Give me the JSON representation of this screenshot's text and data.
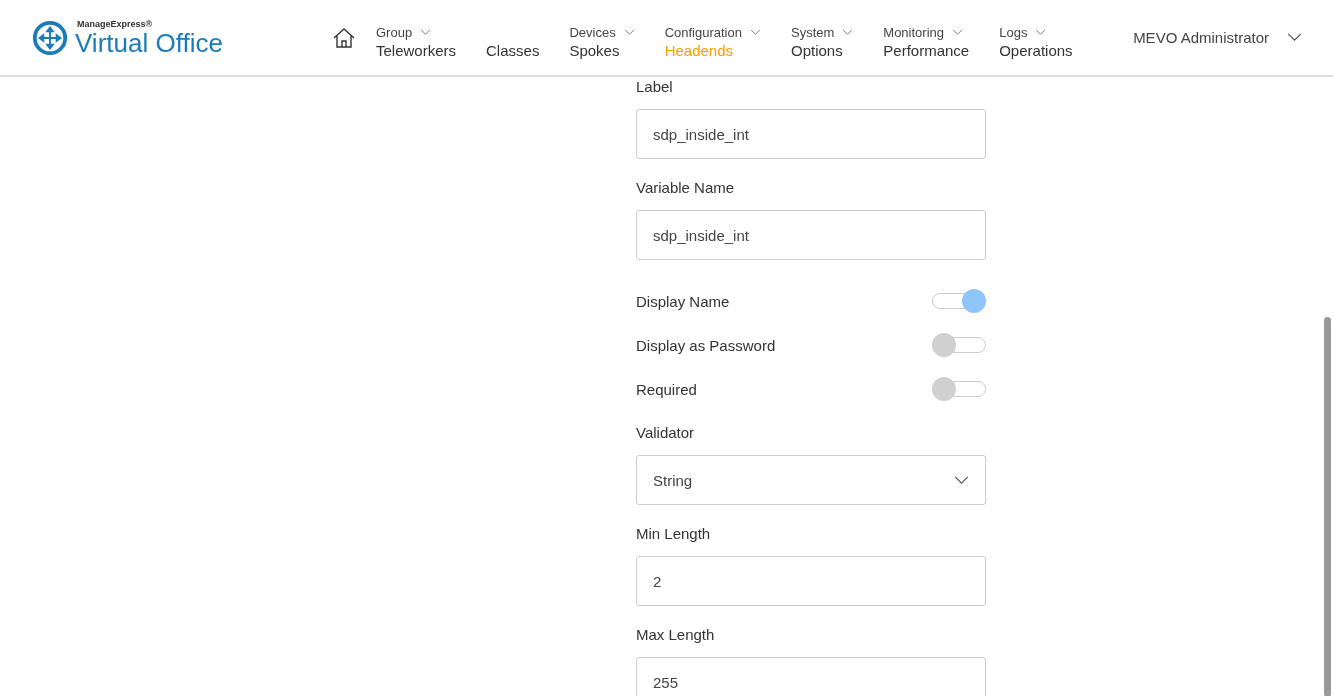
{
  "logo": {
    "brand": "ManageExpress®",
    "product": "Virtual Office"
  },
  "nav": [
    {
      "top": "Group",
      "label": "Teleworkers",
      "selected": false
    },
    {
      "label": "Classes",
      "selected": false
    },
    {
      "top": "Devices",
      "label": "Spokes",
      "selected": false
    },
    {
      "top": "Configuration",
      "label": "Headends",
      "selected": true
    },
    {
      "top": "System",
      "label": "Options",
      "selected": false
    },
    {
      "top": "Monitoring",
      "label": "Performance",
      "selected": false
    },
    {
      "top": "Logs",
      "label": "Operations",
      "selected": false
    }
  ],
  "user": "MEVO Administrator",
  "fields": [
    {
      "kind": "text",
      "label": "Label",
      "value": "sdp_inside_int"
    },
    {
      "kind": "text",
      "label": "Variable Name",
      "value": "sdp_inside_int"
    },
    {
      "kind": "toggle",
      "label": "Display Name",
      "on": true
    },
    {
      "kind": "toggle",
      "label": "Display as Password",
      "on": false
    },
    {
      "kind": "toggle",
      "label": "Required",
      "on": false
    },
    {
      "kind": "select",
      "label": "Validator",
      "value": "String"
    },
    {
      "kind": "text",
      "label": "Min Length",
      "value": "2"
    },
    {
      "kind": "text",
      "label": "Max Length",
      "value": "255"
    }
  ]
}
